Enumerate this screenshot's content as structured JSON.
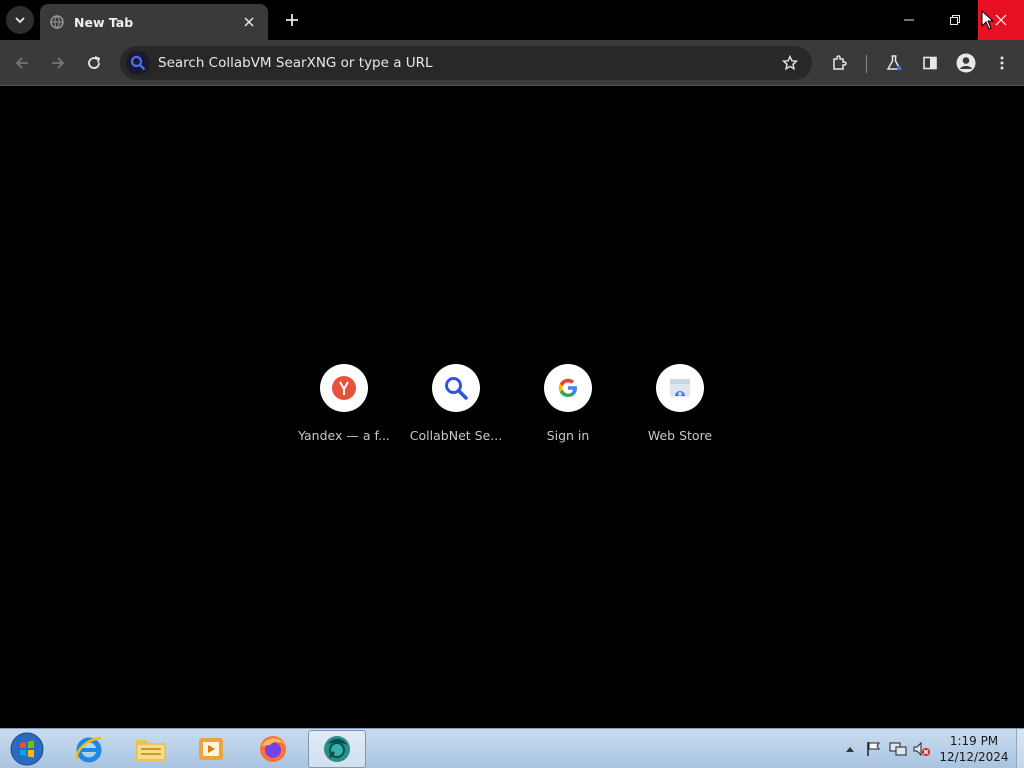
{
  "browser": {
    "tab": {
      "title": "New Tab"
    },
    "omnibox": {
      "placeholder": "Search CollabVM SearXNG or type a URL"
    }
  },
  "shortcuts": [
    {
      "label": "Yandex — a f...",
      "icon": "yandex-icon"
    },
    {
      "label": "CollabNet Se...",
      "icon": "search-icon"
    },
    {
      "label": "Sign in",
      "icon": "google-icon"
    },
    {
      "label": "Web Store",
      "icon": "web-store-icon"
    }
  ],
  "taskbar": {
    "items": [
      "start-orb-icon",
      "internet-explorer-icon",
      "file-explorer-icon",
      "media-player-icon",
      "firefox-icon",
      "chrome-dev-icon"
    ],
    "clock": {
      "time": "1:19 PM",
      "date": "12/12/2024"
    }
  },
  "colors": {
    "close_button": "#e81123",
    "background": "#000000",
    "toolbar": "#3a3a3a"
  }
}
